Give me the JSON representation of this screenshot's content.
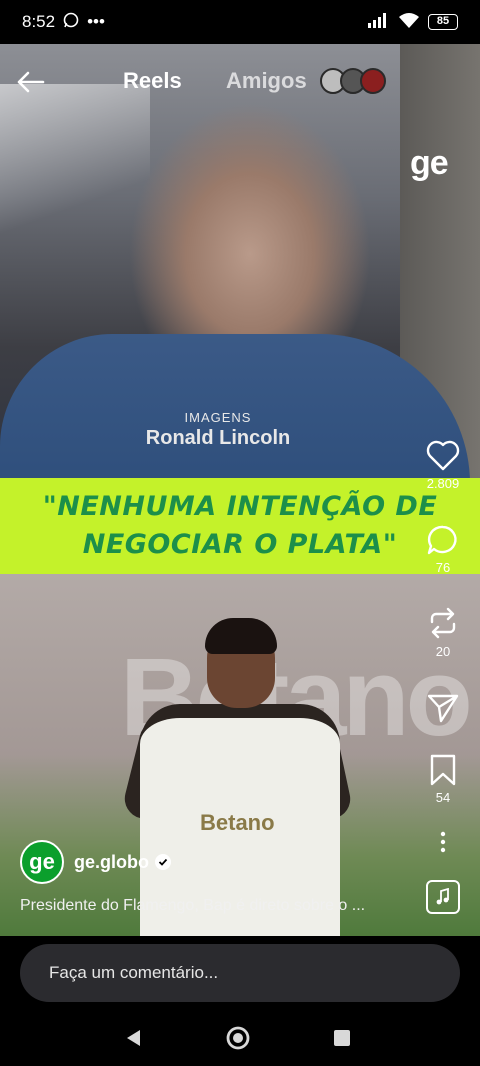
{
  "status_bar": {
    "time": "8:52",
    "notification_icons": [
      "whatsapp-icon",
      "more-icon"
    ],
    "signal_icons": [
      "signal-icon",
      "wifi-icon"
    ],
    "battery": "85"
  },
  "nav": {
    "tabs": [
      {
        "label": "Reels",
        "active": true
      },
      {
        "label": "Amigos",
        "active": false
      }
    ]
  },
  "video": {
    "watermark": "ge",
    "credit_small": "IMAGENS",
    "credit_big": "Ronald Lincoln",
    "quote_line1": "\"NENHUMA INTENÇÃO DE",
    "quote_line2": "NEGOCIAR O PLATA\"",
    "sponsor_text": "Betano",
    "banner_text": "Betano"
  },
  "actions": {
    "likes": "2.809",
    "comments": "76",
    "reposts": "20",
    "saves": "54"
  },
  "author": {
    "avatar_text": "ge",
    "name": "ge.globo",
    "caption": "Presidente do Flamengo, Bap é direto sobre o ..."
  },
  "comment": {
    "placeholder": "Faça um comentário..."
  },
  "colors": {
    "quote_band": "#c4f22a",
    "quote_text": "#1c8f4a",
    "author_avatar": "#0b9f2c",
    "comment_bg": "#2b2b2f"
  }
}
